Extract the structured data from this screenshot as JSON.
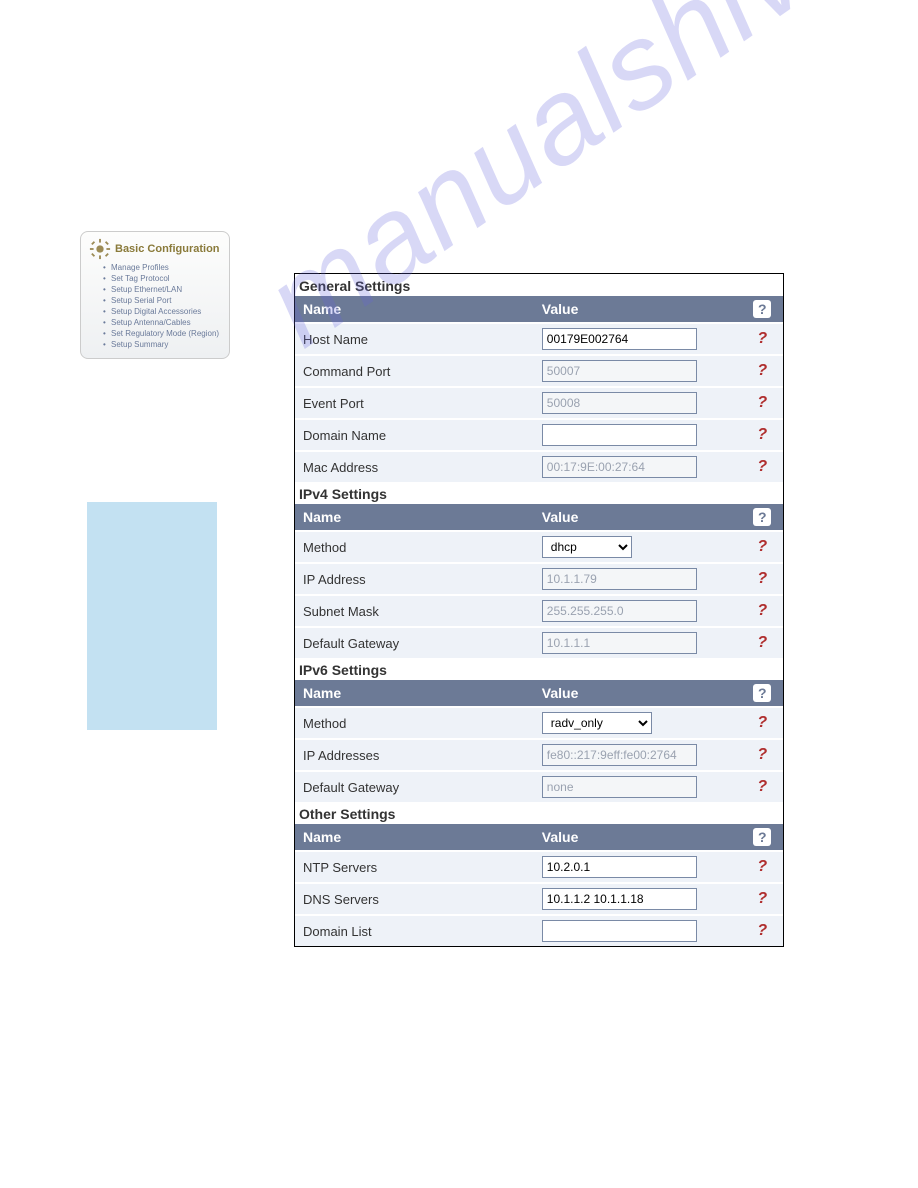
{
  "watermark": "manualshive.com",
  "sidebar": {
    "title": "Basic Configuration",
    "items": [
      "Manage Profiles",
      "Set Tag Protocol",
      "Setup Ethernet/LAN",
      "Setup Serial Port",
      "Setup Digital Accessories",
      "Setup Antenna/Cables",
      "Set Regulatory Mode (Region)",
      "Setup Summary"
    ]
  },
  "sections": {
    "general": {
      "title": "General Settings",
      "name_header": "Name",
      "value_header": "Value",
      "rows": {
        "host_name": {
          "label": "Host Name",
          "value": "00179E002764"
        },
        "command_port": {
          "label": "Command Port",
          "value": "50007"
        },
        "event_port": {
          "label": "Event Port",
          "value": "50008"
        },
        "domain_name": {
          "label": "Domain Name",
          "value": ""
        },
        "mac_address": {
          "label": "Mac Address",
          "value": "00:17:9E:00:27:64"
        }
      }
    },
    "ipv4": {
      "title": "IPv4 Settings",
      "name_header": "Name",
      "value_header": "Value",
      "rows": {
        "method": {
          "label": "Method",
          "value": "dhcp"
        },
        "ip_address": {
          "label": "IP Address",
          "value": "10.1.1.79"
        },
        "subnet_mask": {
          "label": "Subnet Mask",
          "value": "255.255.255.0"
        },
        "default_gateway": {
          "label": "Default Gateway",
          "value": "10.1.1.1"
        }
      }
    },
    "ipv6": {
      "title": "IPv6 Settings",
      "name_header": "Name",
      "value_header": "Value",
      "rows": {
        "method": {
          "label": "Method",
          "value": "radv_only"
        },
        "ip_addresses": {
          "label": "IP Addresses",
          "value": "fe80::217:9eff:fe00:2764"
        },
        "default_gateway": {
          "label": "Default Gateway",
          "value": "none"
        }
      }
    },
    "other": {
      "title": "Other Settings",
      "name_header": "Name",
      "value_header": "Value",
      "rows": {
        "ntp_servers": {
          "label": "NTP Servers",
          "value": "10.2.0.1"
        },
        "dns_servers": {
          "label": "DNS Servers",
          "value": "10.1.1.2 10.1.1.18"
        },
        "domain_list": {
          "label": "Domain List",
          "value": ""
        }
      }
    }
  },
  "help_glyph": "?"
}
